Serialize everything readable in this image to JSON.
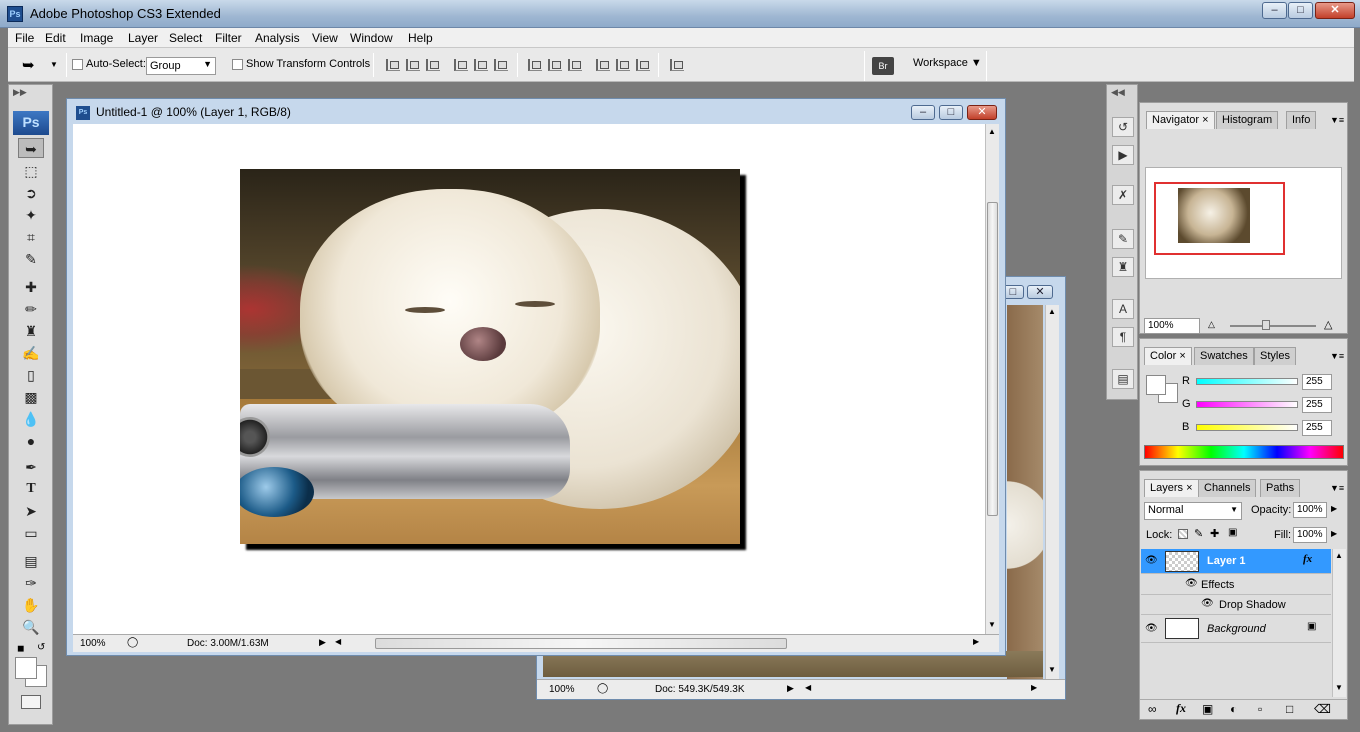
{
  "window": {
    "title": "Adobe Photoshop CS3 Extended",
    "app_icon": "Ps",
    "min": "–",
    "max": "□",
    "close": "✕"
  },
  "menu": [
    "File",
    "Edit",
    "Image",
    "Layer",
    "Select",
    "Filter",
    "Analysis",
    "View",
    "Window",
    "Help"
  ],
  "options": {
    "auto_select_label": "Auto-Select:",
    "auto_select_value": "Group",
    "show_transform_label": "Show Transform Controls",
    "workspace_label": "Workspace ▼"
  },
  "tools": {
    "logo": "Ps"
  },
  "doc_main": {
    "title": "Untitled-1 @ 100% (Layer 1, RGB/8)",
    "icon": "Ps",
    "zoom": "100%",
    "doc_size": "Doc: 3.00M/1.63M"
  },
  "doc_back": {
    "zoom": "100%",
    "doc_size": "Doc: 549.3K/549.3K"
  },
  "navigator": {
    "tabs": [
      "Navigator",
      "Histogram",
      "Info"
    ],
    "zoom": "100%"
  },
  "color": {
    "tabs": [
      "Color",
      "Swatches",
      "Styles"
    ],
    "r_label": "R",
    "g_label": "G",
    "b_label": "B",
    "r": "255",
    "g": "255",
    "b": "255"
  },
  "layers": {
    "tabs": [
      "Layers",
      "Channels",
      "Paths"
    ],
    "blend_mode": "Normal",
    "opacity_label": "Opacity:",
    "opacity": "100%",
    "lock_label": "Lock:",
    "fill_label": "Fill:",
    "fill": "100%",
    "rows": [
      {
        "name": "Layer 1",
        "fx": "fx"
      },
      {
        "name": "Effects"
      },
      {
        "name": "Drop Shadow"
      },
      {
        "name": "Background"
      }
    ]
  },
  "colors": {
    "accent": "#3399ff",
    "title_bg": "#b5c9e0",
    "close_red": "#c2402a"
  }
}
